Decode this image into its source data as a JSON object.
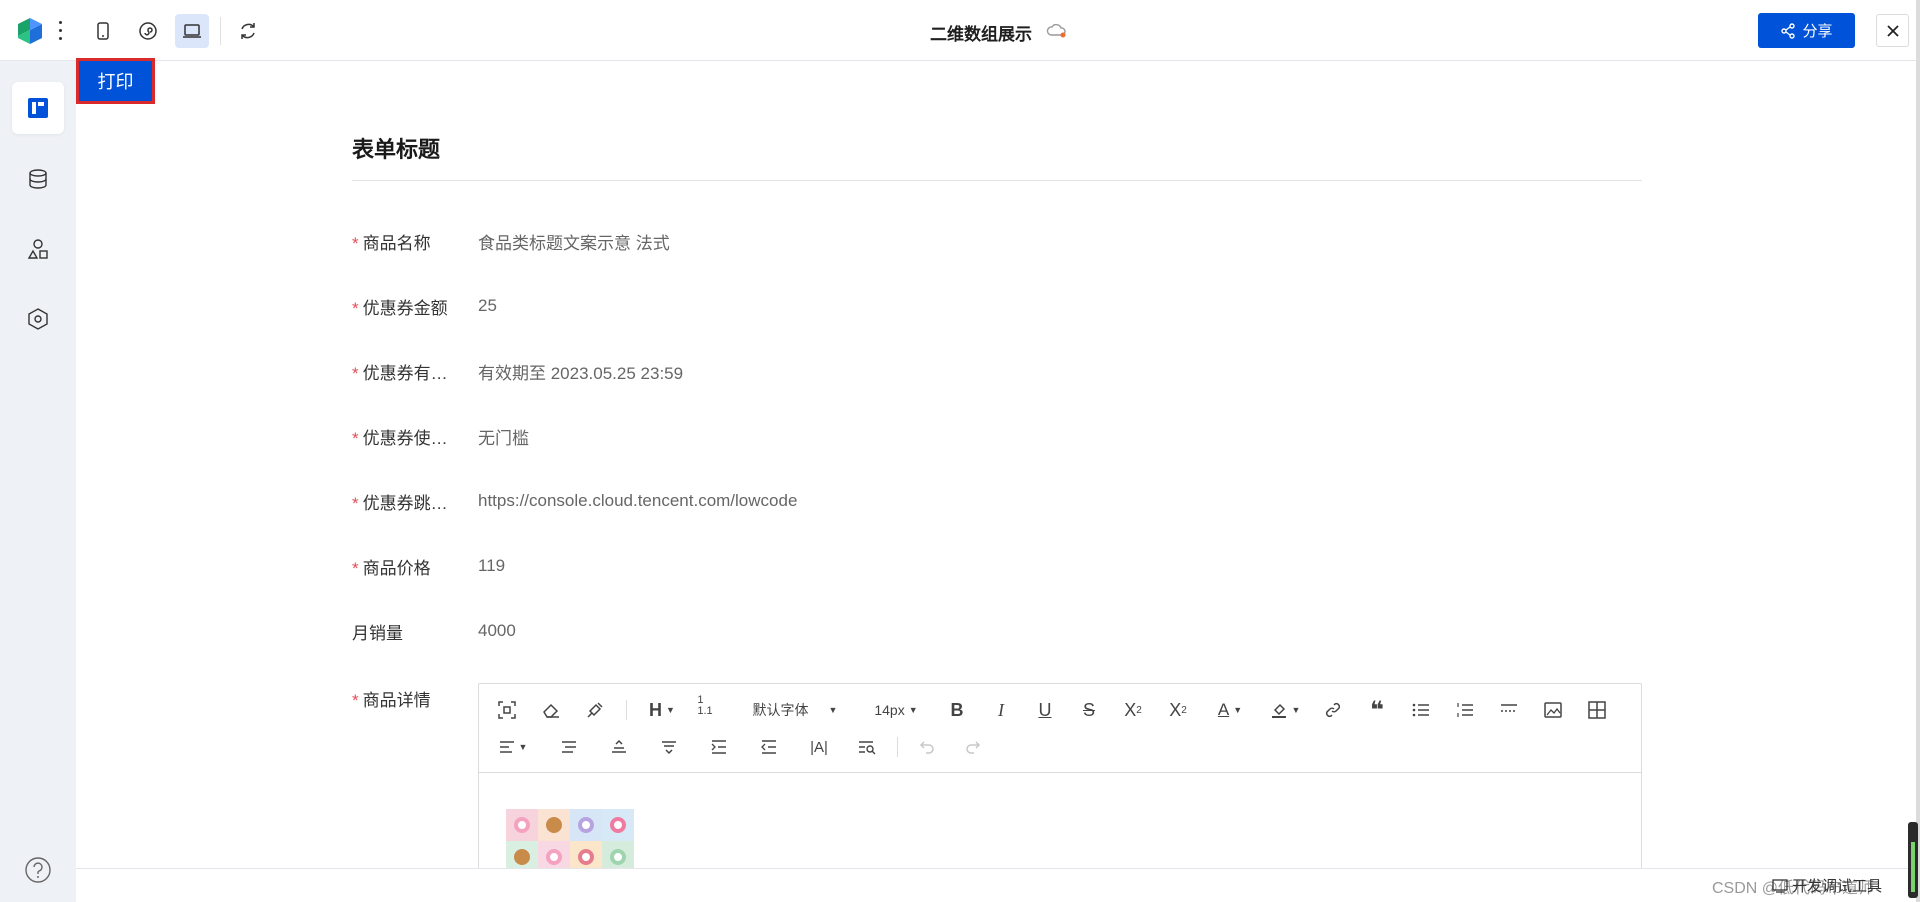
{
  "header": {
    "title": "二维数组展示",
    "share_label": "分享"
  },
  "toolbar": {
    "print_label": "打印"
  },
  "form": {
    "title": "表单标题",
    "fields": [
      {
        "label": "商品名称",
        "required": true,
        "value": "食品类标题文案示意 法式"
      },
      {
        "label": "优惠券金额",
        "required": true,
        "value": "25"
      },
      {
        "label": "优惠券有…",
        "required": true,
        "value": "有效期至 2023.05.25 23:59"
      },
      {
        "label": "优惠券使…",
        "required": true,
        "value": "无门槛"
      },
      {
        "label": "优惠券跳…",
        "required": true,
        "value": "https://console.cloud.tencent.com/lowcode"
      },
      {
        "label": "商品价格",
        "required": true,
        "value": "119"
      },
      {
        "label": "月销量",
        "required": false,
        "value": "4000"
      }
    ],
    "detail_label": "商品详情",
    "detail_required": true
  },
  "editor": {
    "font_family": "默认字体",
    "font_size": "14px"
  },
  "footer": {
    "watermark": "CSDN @低代码布道师",
    "devtools_label": "开发调试工具"
  },
  "colors": {
    "primary": "#0052d9",
    "required": "#e34d59",
    "highlight_border": "#d92b2b"
  }
}
